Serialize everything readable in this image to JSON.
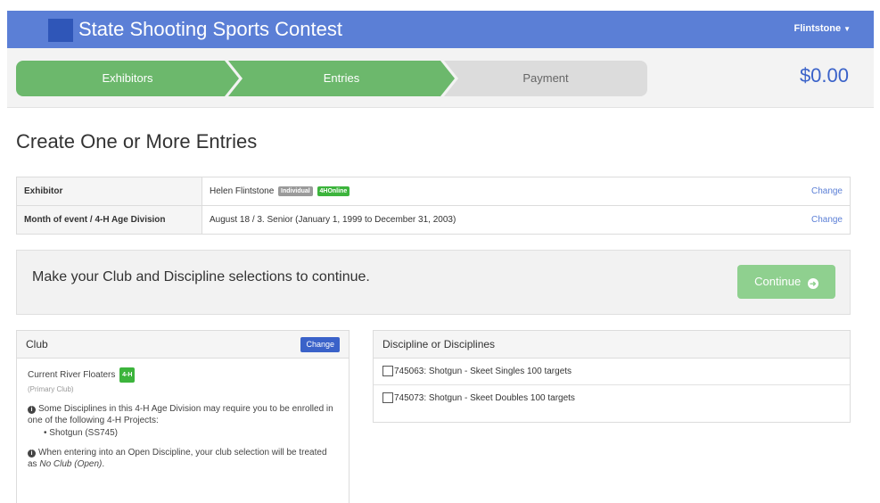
{
  "header": {
    "title": "State Shooting Sports Contest",
    "user": "Flintstone",
    "user_caret": "▼"
  },
  "stepper": {
    "steps": [
      {
        "label": "Exhibitors"
      },
      {
        "label": "Entries"
      },
      {
        "label": "Payment"
      }
    ],
    "total": "$0.00"
  },
  "page": {
    "title": "Create One or More Entries"
  },
  "summary": {
    "rows": [
      {
        "label": "Exhibitor",
        "value": "Helen Flintstone",
        "badges": [
          "Individual",
          "4HOnline"
        ],
        "action": "Change"
      },
      {
        "label": "Month of event / 4-H Age Division",
        "value": "August 18  /  3. Senior (January 1, 1999 to December 31, 2003)",
        "action": "Change"
      }
    ]
  },
  "alert": {
    "message": "Make your Club and Discipline selections to continue.",
    "button_label": "Continue",
    "button_icon": "➜"
  },
  "club": {
    "heading": "Club",
    "change_label": "Change",
    "name": "Current River Floaters",
    "badge": "4-H",
    "note": "(Primary Club)",
    "info1": "Some Disciplines in this 4-H Age Division may require you to be enrolled in one of the following 4-H Projects:",
    "projects": [
      "Shotgun (SS745)"
    ],
    "info2_prefix": "When entering into an Open Discipline, your club selection will be treated as ",
    "info2_emph": "No Club (Open)",
    "info2_suffix": "."
  },
  "disciplines": {
    "heading": "Discipline or Disciplines",
    "items": [
      {
        "label": "745063: Shotgun - Skeet Singles 100 targets",
        "checked": false
      },
      {
        "label": "745073: Shotgun - Skeet Doubles 100 targets",
        "checked": false
      }
    ]
  },
  "colors": {
    "header_bg": "#5b7fd6",
    "step_complete": "#6cb86c",
    "step_pending": "#dcdcdc",
    "total_text": "#3a62c9",
    "continue_btn": "#8fd08f"
  }
}
